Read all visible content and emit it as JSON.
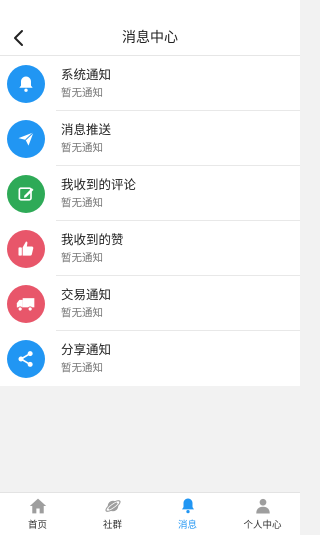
{
  "header": {
    "title": "消息中心"
  },
  "messages": [
    {
      "title": "系统通知",
      "subtitle": "暂无通知",
      "icon": "bell-icon",
      "color": "#2196f3"
    },
    {
      "title": "消息推送",
      "subtitle": "暂无通知",
      "icon": "paper-plane-icon",
      "color": "#2196f3"
    },
    {
      "title": "我收到的评论",
      "subtitle": "暂无通知",
      "icon": "edit-icon",
      "color": "#2eaa57"
    },
    {
      "title": "我收到的赞",
      "subtitle": "暂无通知",
      "icon": "thumbs-up-icon",
      "color": "#e8566a"
    },
    {
      "title": "交易通知",
      "subtitle": "暂无通知",
      "icon": "truck-icon",
      "color": "#e8566a"
    },
    {
      "title": "分享通知",
      "subtitle": "暂无通知",
      "icon": "share-icon",
      "color": "#2196f3"
    }
  ],
  "tabbar": {
    "active_color": "#2196f3",
    "items": [
      {
        "label": "首页",
        "icon": "home-icon",
        "active": false
      },
      {
        "label": "社群",
        "icon": "planet-icon",
        "active": false
      },
      {
        "label": "消息",
        "icon": "bell-icon",
        "active": true
      },
      {
        "label": "个人中心",
        "icon": "person-icon",
        "active": false
      }
    ]
  }
}
